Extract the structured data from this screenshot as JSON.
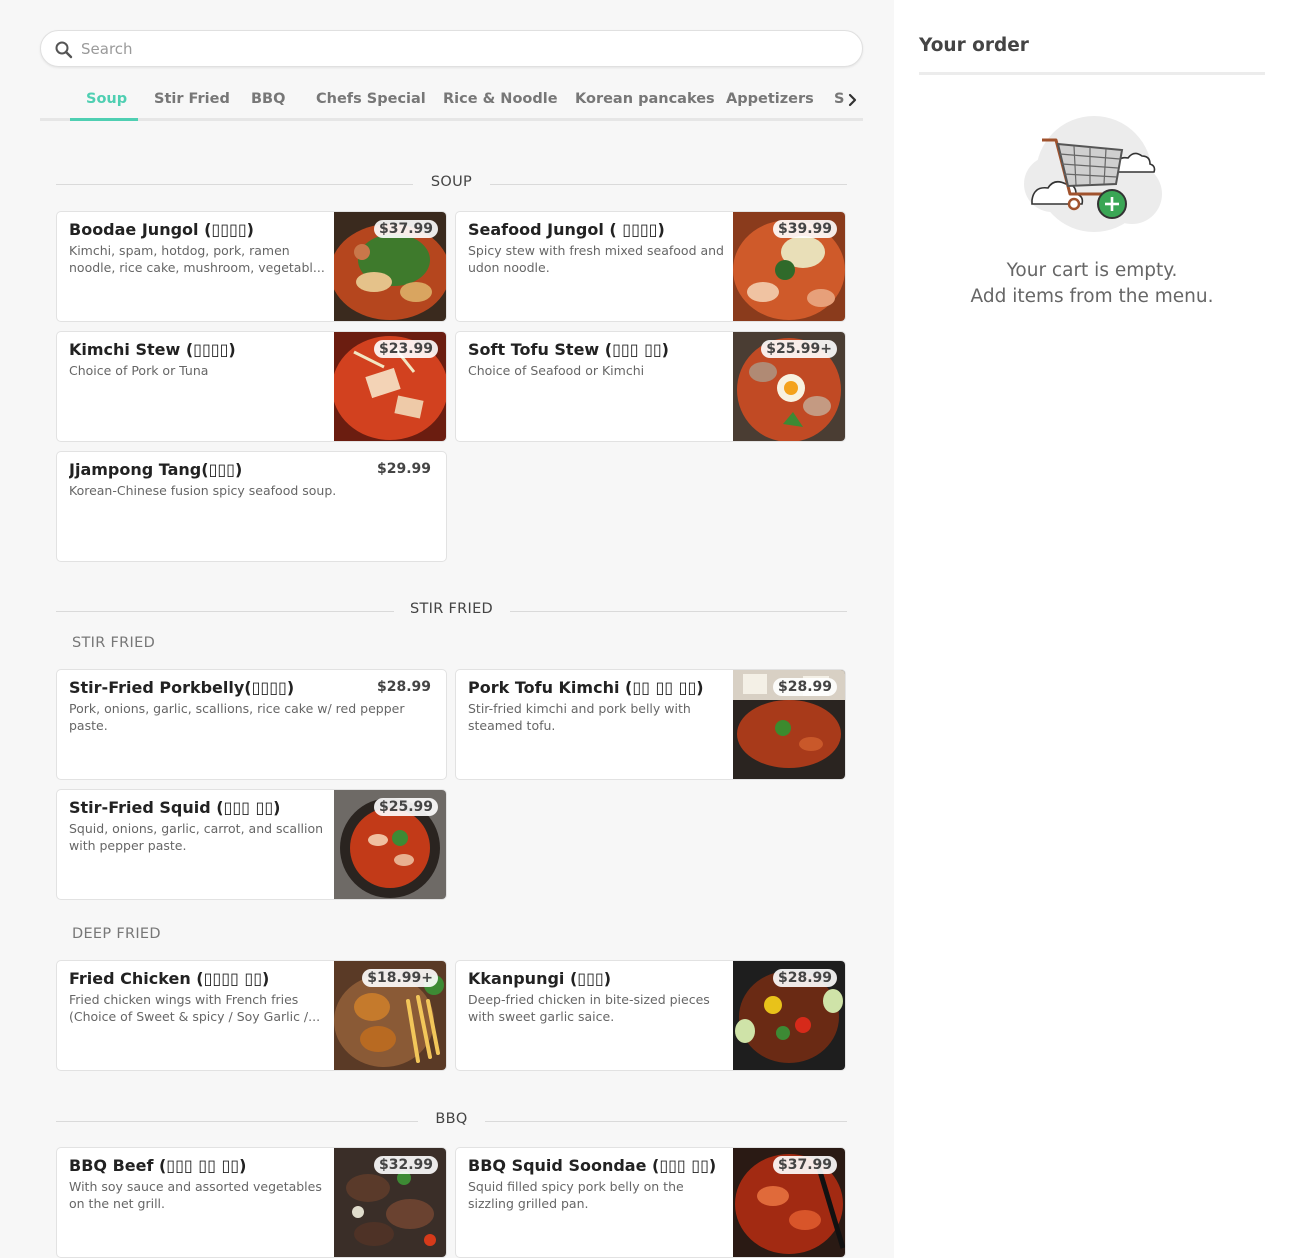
{
  "search": {
    "placeholder": "Search"
  },
  "tabs": [
    {
      "label": "Soup"
    },
    {
      "label": "Stir Fried"
    },
    {
      "label": "BBQ"
    },
    {
      "label": "Chefs Special"
    },
    {
      "label": "Rice & Noodle"
    },
    {
      "label": "Korean pancakes"
    },
    {
      "label": "Appetizers"
    },
    {
      "label": "S"
    }
  ],
  "sections": {
    "soup": "SOUP",
    "stir_fried": "STIR FRIED",
    "stir_fried_sub": "STIR FRIED",
    "deep_fried_sub": "DEEP FRIED",
    "bbq": "BBQ"
  },
  "items": [
    {
      "name": "Boodae Jungol (▯▯▯▯)",
      "desc": "Kimchi, spam, hotdog, pork, ramen noodle, rice cake, mushroom, vegetabl...",
      "price": "$37.99"
    },
    {
      "name": "Seafood Jungol ( ▯▯▯▯)",
      "desc": "Spicy stew with fresh mixed seafood and udon noodle.",
      "price": "$39.99"
    },
    {
      "name": "Kimchi Stew (▯▯▯▯)",
      "desc": "Choice of Pork or Tuna",
      "price": "$23.99"
    },
    {
      "name": "Soft Tofu Stew (▯▯▯ ▯▯)",
      "desc": "Choice of Seafood or Kimchi",
      "price": "$25.99+"
    },
    {
      "name": "Jjampong Tang(▯▯▯)",
      "desc": "Korean-Chinese fusion spicy seafood soup.",
      "price": "$29.99"
    },
    {
      "name": "Stir-Fried Porkbelly(▯▯▯▯)",
      "desc": "Pork, onions, garlic, scallions, rice cake w/ red pepper paste.",
      "price": "$28.99"
    },
    {
      "name": "Pork Tofu Kimchi (▯▯ ▯▯ ▯▯)",
      "desc": "Stir-fried kimchi and pork belly with steamed tofu.",
      "price": "$28.99"
    },
    {
      "name": "Stir-Fried Squid (▯▯▯ ▯▯)",
      "desc": "Squid, onions, garlic, carrot, and scallion with pepper paste.",
      "price": "$25.99"
    },
    {
      "name": "Fried Chicken (▯▯▯▯ ▯▯)",
      "desc": "Fried chicken wings with French fries (Choice of Sweet & spicy / Soy Garlic /...",
      "price": "$18.99+"
    },
    {
      "name": "Kkanpungi (▯▯▯)",
      "desc": "Deep-fried chicken in bite-sized pieces with sweet garlic saice.",
      "price": "$28.99"
    },
    {
      "name": "BBQ Beef (▯▯▯ ▯▯ ▯▯)",
      "desc": "With soy sauce and assorted vegetables on the net grill.",
      "price": "$32.99"
    },
    {
      "name": "BBQ Squid Soondae (▯▯▯ ▯▯)",
      "desc": "Squid filled spicy pork belly on the sizzling grilled pan.",
      "price": "$37.99"
    }
  ],
  "order": {
    "title": "Your order",
    "empty_line1": "Your cart is empty.",
    "empty_line2": "Add items from the menu."
  },
  "colors": {
    "accent": "#4fcfb2",
    "cart_green": "#3aa655"
  }
}
